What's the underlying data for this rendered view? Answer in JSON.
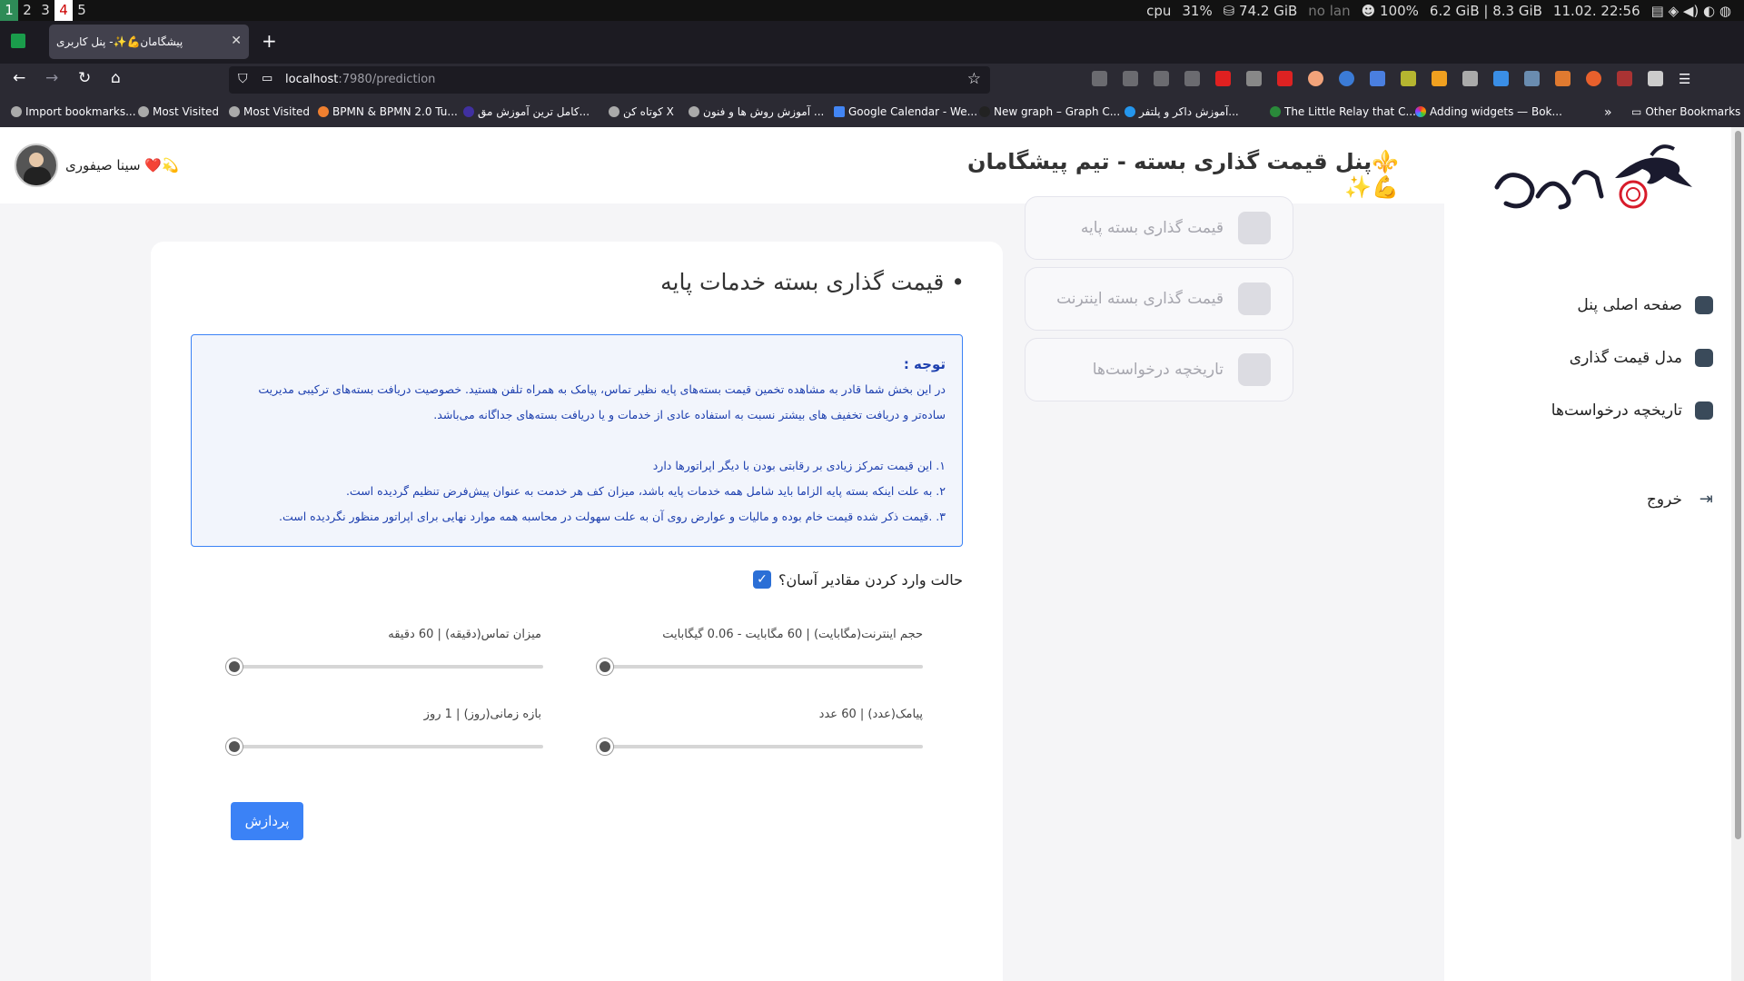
{
  "system_bar": {
    "workspaces": [
      "1",
      "2",
      "3",
      "4",
      "5"
    ],
    "cpu_label": "cpu",
    "cpu_value": "31%",
    "disk": "74.2 GiB",
    "network": "no lan",
    "battery": "100%",
    "memory": "6.2 GiB | 8.3 GiB",
    "datetime": "11.02. 22:56"
  },
  "browser": {
    "tab_title": "پیشگامان💪✨- پنل کاربری",
    "url_host": "localhost",
    "url_path": ":7980/prediction",
    "bookmarks": [
      "Import bookmarks...",
      "Most Visited",
      "Most Visited",
      "BPMN & BPMN 2.0 Tu...",
      "کامل ترین آموزش مق...",
      "کوتاه کن X",
      "آموزش روش ها و فنون ...",
      "Google Calendar - We...",
      "New graph – Graph C...",
      "آموزش داکر و پلتفر...",
      "The Little Relay that C...",
      "Adding widgets — Bok..."
    ],
    "other_bookmarks": "Other Bookmarks"
  },
  "header": {
    "title": "⚜️پنل قیمت گذاری بسته - تیم پیشگامان 💪✨",
    "username": "💫❤️ سینا صیفوری"
  },
  "sidebar": {
    "items": [
      {
        "label": "صفحه اصلی پنل",
        "icon": "home-icon"
      },
      {
        "label": "مدل قیمت گذاری",
        "icon": "wallet-icon"
      },
      {
        "label": "تاریخچه درخواست‌ها",
        "icon": "history-icon"
      },
      {
        "label": "خروج",
        "icon": "logout-icon"
      }
    ]
  },
  "cards": [
    {
      "label": "قیمت گذاری بسته پایه",
      "icon": "document-icon"
    },
    {
      "label": "قیمت گذاری بسته اینترنت",
      "icon": "mobile-icon"
    },
    {
      "label": "تاریخچه درخواست‌ها",
      "icon": "chart-icon"
    }
  ],
  "main": {
    "title": "قیمت گذاری بسته خدمات پایه",
    "notice": {
      "title": "توجه :",
      "line1": "در این بخش شما قادر به مشاهده تخمین قیمت بسته‌های پایه نظیر تماس، پیامک به همراه تلفن هستید. خصوصیت دریافت بسته‌های ترکیبی مدیریت",
      "line2": "ساده‌تر و دریافت تخفیف های بیشتر نسبت به استفاده عادی از خدمات و یا دریافت بسته‌های جداگانه می‌باشد.",
      "item1": "۱. این قیمت تمرکز زیادی بر رقابتی بودن با دیگر اپراتورها دارد",
      "item2": "۲. به علت اینکه بسته پایه الزاما باید شامل همه خدمات پایه باشد، میزان کف هر خدمت به عنوان پیش‌فرض تنظیم گردیده است.",
      "item3": "۳. .قیمت ذکر شده قیمت خام بوده و مالیات و عوارض روی آن به علت سهولت در محاسبه همه موارد نهایی برای اپراتور منظور نگردیده است."
    },
    "easy_mode_label": "حالت وارد کردن مقادیر آسان؟",
    "easy_mode_checked": true,
    "sliders": [
      {
        "label": "حجم اینترنت(مگابایت) | 60 مگابایت - 0.06 گیگابایت",
        "value": 60
      },
      {
        "label": "میزان تماس(دقیقه) | 60 دقیقه",
        "value": 60
      },
      {
        "label": "پیامک(عدد) | 60 عدد",
        "value": 60
      },
      {
        "label": "بازه زمانی(روز) | 1 روز",
        "value": 1
      }
    ],
    "submit_label": "پردازش"
  }
}
